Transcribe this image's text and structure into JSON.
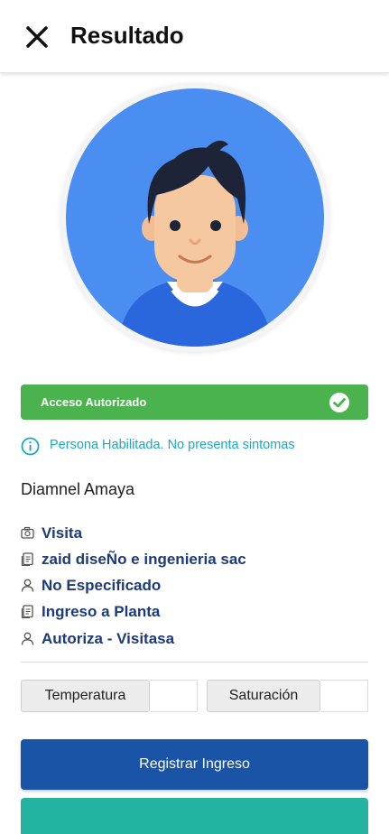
{
  "appbar": {
    "title": "Resultado",
    "close_icon": "close-icon"
  },
  "profile": {
    "avatar": "avatar-illustration"
  },
  "status": {
    "label": "Acceso Autorizado",
    "color": "#4bb34e",
    "icon": "check-circle-icon"
  },
  "info": {
    "text": "Persona Habilitada. No presenta sintomas",
    "color": "#19a9c6",
    "icon": "info-icon"
  },
  "person": {
    "name": "Diamnel Amaya"
  },
  "details": [
    {
      "icon": "camera-icon",
      "text": "Visita"
    },
    {
      "icon": "document-icon",
      "text": "zaid diseÑo e ingenieria sac"
    },
    {
      "icon": "person-icon",
      "text": "No Especificado"
    },
    {
      "icon": "document-icon",
      "text": "Ingreso a Planta"
    },
    {
      "icon": "person-icon",
      "text": "Autoriza - Visitasa"
    }
  ],
  "measurements": {
    "temperature": {
      "label": "Temperatura",
      "value": ""
    },
    "saturation": {
      "label": "Saturación",
      "value": ""
    }
  },
  "actions": {
    "register_label": "Registrar Ingreso",
    "primary_color": "#1a54a6",
    "secondary_color": "#22b4a0"
  }
}
